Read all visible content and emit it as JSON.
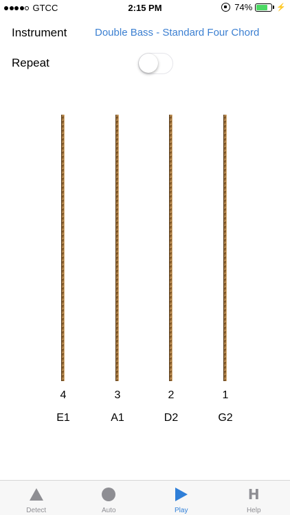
{
  "status_bar": {
    "carrier": "GTCC",
    "time": "2:15 PM",
    "battery_percent": "74%",
    "battery_level": 0.74,
    "signal_bars_filled": 4,
    "signal_bars_total": 5
  },
  "settings": {
    "instrument_label": "Instrument",
    "instrument_value": "Double Bass - Standard Four Chord",
    "repeat_label": "Repeat",
    "repeat_on": false
  },
  "strings": [
    {
      "number": "4",
      "note": "E1"
    },
    {
      "number": "3",
      "note": "A1"
    },
    {
      "number": "2",
      "note": "D2"
    },
    {
      "number": "1",
      "note": "G2"
    }
  ],
  "tab_bar": {
    "tabs": [
      {
        "label": "Detect",
        "icon": "triangle-icon",
        "active": false
      },
      {
        "label": "Auto",
        "icon": "circle-icon",
        "active": false
      },
      {
        "label": "Play",
        "icon": "play-icon",
        "active": true
      },
      {
        "label": "Help",
        "icon": "help-icon",
        "active": false,
        "glyph": "H"
      }
    ]
  },
  "colors": {
    "accent": "#2f7fd8",
    "link": "#3b7fd1",
    "inactive": "#8e8e93",
    "battery": "#4cd964",
    "string_wood": "#8a6230"
  }
}
